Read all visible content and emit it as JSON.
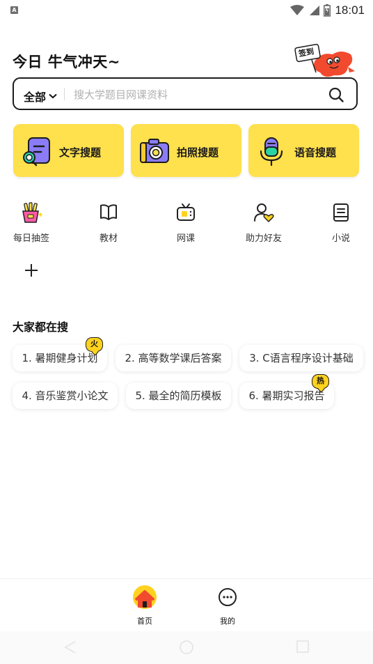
{
  "status_bar": {
    "time": "18:01",
    "notification_badge": "A",
    "icons": [
      "wifi-icon",
      "cell-signal-icon",
      "battery-icon"
    ]
  },
  "header": {
    "greeting": "今日 牛气冲天~",
    "sign_in_badge": "签到"
  },
  "search": {
    "scope_label": "全部",
    "placeholder": "搜大学题目网课资料"
  },
  "search_modes": [
    {
      "label": "文字搜题",
      "icon": "text-search-icon"
    },
    {
      "label": "拍照搜题",
      "icon": "camera-icon"
    },
    {
      "label": "语音搜题",
      "icon": "microphone-icon"
    }
  ],
  "quick_links": [
    {
      "label": "每日抽签",
      "icon": "fortune-sticks-icon"
    },
    {
      "label": "教材",
      "icon": "book-icon"
    },
    {
      "label": "网课",
      "icon": "tv-icon"
    },
    {
      "label": "助力好友",
      "icon": "friend-heart-icon"
    },
    {
      "label": "小说",
      "icon": "novel-icon"
    }
  ],
  "trending": {
    "title": "大家都在搜",
    "items": [
      {
        "text": "1. 暑期健身计划",
        "badge": "火"
      },
      {
        "text": "2. 高等数学课后答案",
        "badge": ""
      },
      {
        "text": "3. C语言程序设计基础",
        "badge": ""
      },
      {
        "text": "4. 音乐鉴赏小论文",
        "badge": ""
      },
      {
        "text": "5. 最全的简历模板",
        "badge": ""
      },
      {
        "text": "6. 暑期实习报告",
        "badge": "热"
      }
    ]
  },
  "tab_bar": {
    "tabs": [
      {
        "label": "首页",
        "icon": "home-icon",
        "active": true
      },
      {
        "label": "我的",
        "icon": "profile-icon",
        "active": false
      }
    ]
  },
  "colors": {
    "accent_yellow": "#ffe04d",
    "badge_yellow": "#ffd21f",
    "outline": "#1c1c1c",
    "icon_purple": "#8b7cf6",
    "mascot_red": "#f24a2e"
  }
}
